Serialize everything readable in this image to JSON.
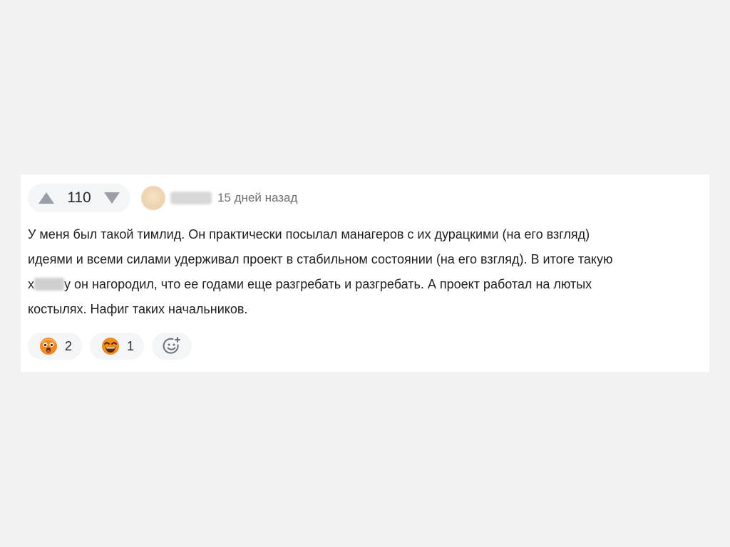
{
  "comment": {
    "rating": "110",
    "time": "15 дней назад",
    "text_line1": "У меня был такой тимлид. Он практически посылал манагеров с их дурацкими (на его взгляд)",
    "text_line2": "идеями и всеми силами удерживал проект в стабильном состоянии (на его взгляд). В итоге такую",
    "text_line3_prefix": "х",
    "text_line3_suffix": "у он нагородил, что ее годами еще разгребать и разгребать. А проект работал на лютых",
    "text_line4": "костылях. Нафиг таких начальников."
  },
  "reactions": [
    {
      "icon": "scared-face-icon",
      "count": "2"
    },
    {
      "icon": "grinning-squint-face-icon",
      "count": "1"
    }
  ],
  "colors": {
    "background": "#f2f2f2",
    "card": "#ffffff",
    "pill": "#f4f5f7",
    "vote_arrow": "#9a9ea6",
    "emoji_orange": "#f08a24"
  }
}
